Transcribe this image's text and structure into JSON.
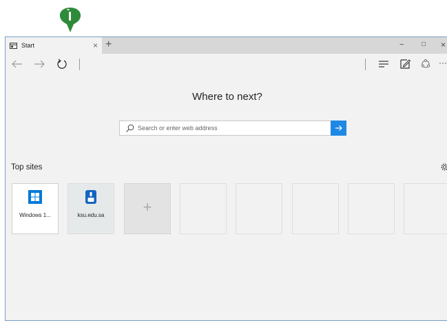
{
  "tab": {
    "title": "Start",
    "icon": "page-icon",
    "close": "×"
  },
  "new_tab": "+",
  "window_controls": {
    "minimize": "−",
    "maximize": "□",
    "close": "×"
  },
  "nav": {
    "back": "arrow-left-icon",
    "forward": "arrow-right-icon",
    "refresh": "refresh-icon",
    "hub": "hub-icon",
    "note": "web-note-icon",
    "share": "share-icon",
    "more": "···"
  },
  "main": {
    "headline": "Where to next?",
    "search": {
      "placeholder": "Search or enter web address",
      "value": ""
    },
    "top_sites_title": "Top sites",
    "tiles": [
      {
        "label": "Windows 1...",
        "icon": "windows-logo-icon"
      },
      {
        "label": "ksu.edu.sa",
        "icon": "ksu-logo-icon"
      }
    ],
    "add_tile": "+"
  },
  "colors": {
    "accent": "#1e88e5",
    "logo_green": "#2e8b3a",
    "window_border": "#7a9cc6"
  }
}
